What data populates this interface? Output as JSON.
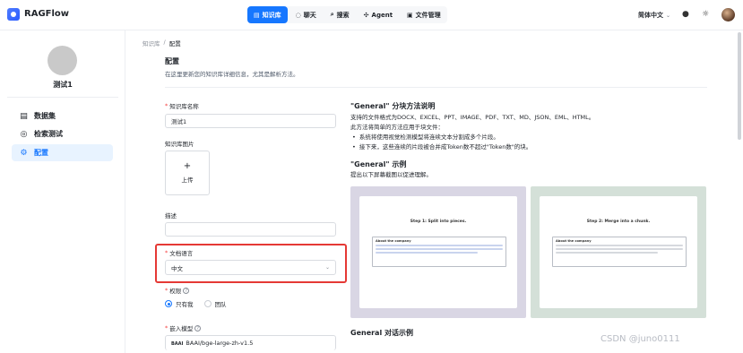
{
  "app": {
    "brand": "RAGFlow"
  },
  "nav": {
    "items": [
      {
        "label": "知识库",
        "icon": "knowledge-base-icon",
        "active": true
      },
      {
        "label": "聊天",
        "icon": "chat-icon",
        "active": false
      },
      {
        "label": "搜索",
        "icon": "search-icon",
        "active": false
      },
      {
        "label": "Agent",
        "icon": "agent-icon",
        "active": false
      },
      {
        "label": "文件管理",
        "icon": "file-icon",
        "active": false
      }
    ],
    "language": "简体中文"
  },
  "sidebar": {
    "kb_name": "测试1",
    "items": [
      {
        "label": "数据集",
        "icon": "dataset-icon"
      },
      {
        "label": "检索测试",
        "icon": "retrieval-test-icon"
      },
      {
        "label": "配置",
        "icon": "settings-icon"
      }
    ]
  },
  "breadcrumb": {
    "root": "知识库",
    "sep": "/",
    "current": "配置"
  },
  "header": {
    "title": "配置",
    "subtitle": "在这里更新您的知识库详细信息，尤其是解析方法。"
  },
  "form": {
    "name_label": "知识库名称",
    "name_value": "测试1",
    "image_label": "知识库图片",
    "upload_plus": "+",
    "upload_label": "上传",
    "desc_label": "描述",
    "desc_value": "",
    "lang_label": "文档语言",
    "lang_value": "中文",
    "perm_label": "权限",
    "perm_options": [
      "只有我",
      "团队"
    ],
    "perm_selected": "只有我",
    "embed_label": "嵌入模型",
    "embed_value": "BAAI/bge-large-zh-v1.5"
  },
  "description": {
    "title": "\"General\" 分块方法说明",
    "line1": "支持的文件格式为DOCX、EXCEL、PPT、IMAGE、PDF、TXT、MD、JSON、EML、HTML。",
    "line2": "此方法将简单的方法应用于块文件：",
    "bullets": [
      "系统将使用视觉检测模型将连续文本分割成多个片段。",
      "接下来，这些连续的片段被合并成Token数不超过\"Token数\"的块。"
    ],
    "example_title": "\"General\" 示例",
    "example_sub": "提出以下屏幕截图以促进理解。",
    "step1": "Step 1: Split into pieces.",
    "step2": "Step 2: Merge into a chunk.",
    "about": "About the company",
    "dialog_title": "General 对话示例"
  },
  "colors": {
    "accent": "#1677ff",
    "highlight_box": "#e53935",
    "thumb1_bg": "#d9d6e4",
    "thumb2_bg": "#d4e0d8"
  },
  "watermark": "CSDN @juno0111"
}
